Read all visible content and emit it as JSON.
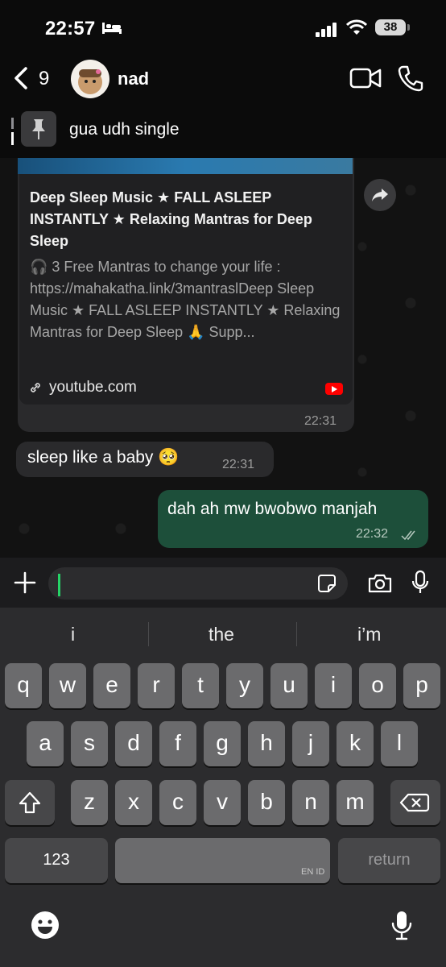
{
  "status_bar": {
    "time": "22:57",
    "battery": "38"
  },
  "header": {
    "back_count": "9",
    "contact_name": "nad"
  },
  "pinned": {
    "text": "gua udh single"
  },
  "messages": {
    "link_card": {
      "title": "Deep Sleep Music ★  FALL ASLEEP INSTANTLY ★ Relaxing Mantras for Deep Sleep",
      "description": "🎧 3 Free Mantras to change your life : https://mahakatha.link/3mantraslDeep Sleep Music ★  FALL ASLEEP INSTANTLY ★ Relaxing Mantras for Deep Sleep 🙏 Supp...",
      "domain": "youtube.com",
      "time": "22:31"
    },
    "incoming": {
      "text": "sleep like a baby 🥺",
      "time": "22:31"
    },
    "outgoing": {
      "text": "dah ah mw bwobwo manjah",
      "time": "22:32"
    }
  },
  "composer": {
    "placeholder": ""
  },
  "keyboard": {
    "suggestions": [
      "i",
      "the",
      "i’m"
    ],
    "row1": [
      "q",
      "w",
      "e",
      "r",
      "t",
      "y",
      "u",
      "i",
      "o",
      "p"
    ],
    "row2": [
      "a",
      "s",
      "d",
      "f",
      "g",
      "h",
      "j",
      "k",
      "l"
    ],
    "row3": [
      "z",
      "x",
      "c",
      "v",
      "b",
      "n",
      "m"
    ],
    "numbers_label": "123",
    "language_label": "EN ID",
    "return_label": "return"
  },
  "colors": {
    "outgoing_bubble": "#1d4f3a",
    "accent": "#25d366",
    "incoming_bubble": "#2a2a2c"
  }
}
